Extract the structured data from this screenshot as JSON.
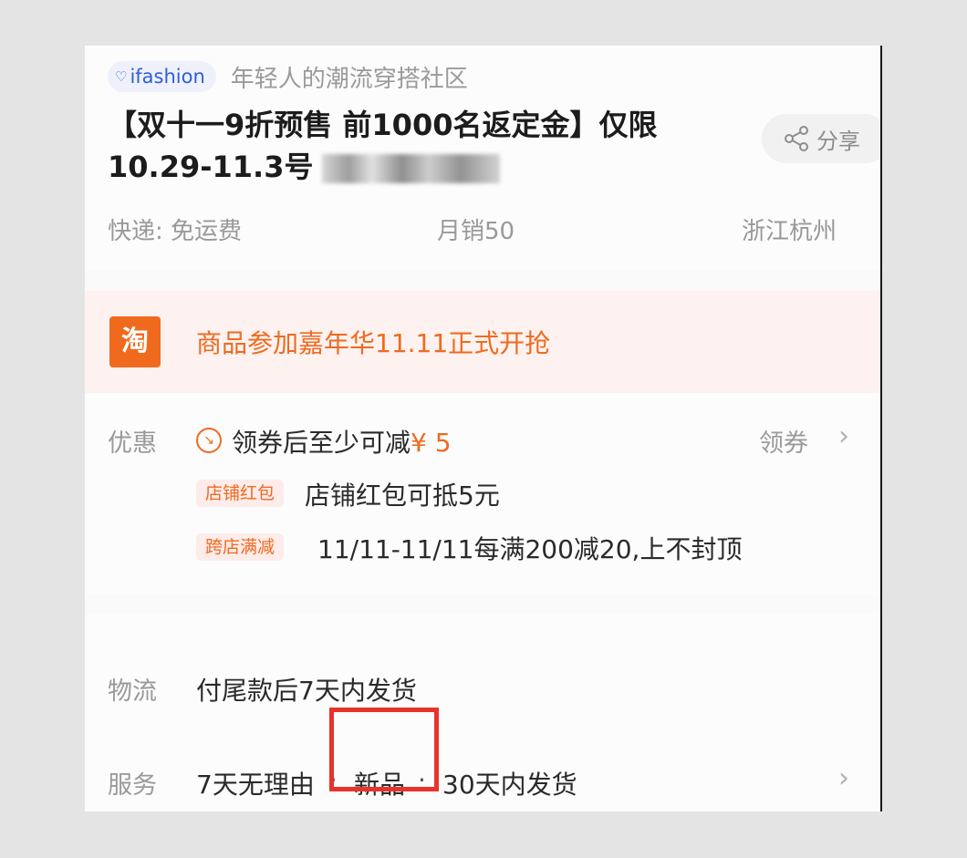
{
  "brand": {
    "name": "ifashion",
    "tagline": "年轻人的潮流穿搭社区"
  },
  "title": "【双十一9折预售 前1000名返定金】仅限10.29-11.3号",
  "share_label": "分享",
  "meta": {
    "shipping": "快递: 免运费",
    "sales": "月销50",
    "location": "浙江杭州"
  },
  "carnival": {
    "icon": "淘",
    "text": "商品参加嘉年华11.11正式开抢"
  },
  "promo": {
    "label": "优惠",
    "coupon_text": "领券后至少可减",
    "coupon_amount": "¥ 5",
    "coupon_link": "领券",
    "items": [
      {
        "tag": "店铺红包",
        "text": "店铺红包可抵5元"
      },
      {
        "tag": "跨店满减",
        "text": "11/11-11/11每满200减20,上不封顶"
      }
    ]
  },
  "logistics": {
    "label": "物流",
    "text": "付尾款后7天内发货"
  },
  "service": {
    "label": "服务",
    "items": [
      "7天无理由",
      "新品",
      "30天内发货"
    ],
    "separator": "·"
  }
}
